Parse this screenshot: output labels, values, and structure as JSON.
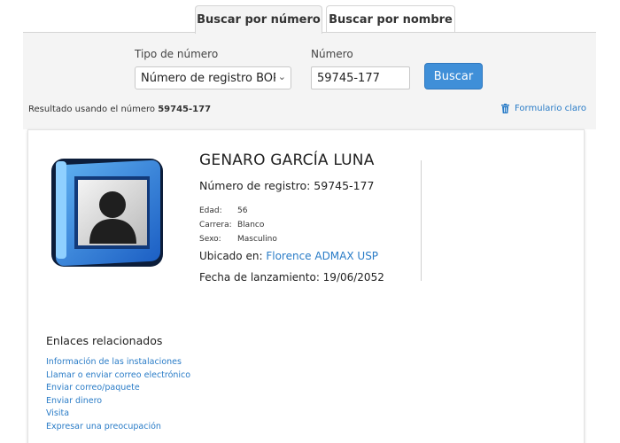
{
  "tabs": [
    {
      "label": "Buscar por número",
      "active": true
    },
    {
      "label": "Buscar por nombre",
      "active": false
    }
  ],
  "search": {
    "type_label": "Tipo de número",
    "type_value": "Número de registro BOP",
    "number_label": "Número",
    "number_value": "59745-177",
    "button_label": "Buscar"
  },
  "result": {
    "prefix": "Resultado usando el número",
    "number": "59745-177",
    "clear_label": "Formulario claro"
  },
  "person": {
    "name": "GENARO GARCÍA LUNA",
    "registration": "Número de registro: 59745-177",
    "details": [
      {
        "key": "Edad:",
        "value": "56"
      },
      {
        "key": "Carrera:",
        "value": "Blanco"
      },
      {
        "key": "Sexo:",
        "value": "Masculino"
      }
    ],
    "located_prefix": "Ubicado en:",
    "located_link": "Florence ADMAX USP",
    "release": "Fecha de lanzamiento: 19/06/2052"
  },
  "related": {
    "title": "Enlaces relacionados",
    "links": [
      "Información de las instalaciones",
      "Llamar o enviar correo electrónico",
      "Enviar correo/paquete",
      "Enviar dinero",
      "Visita",
      "Expresar una preocupación"
    ]
  },
  "colors": {
    "accent": "#3f8fd8",
    "link": "#2a7cc7",
    "panel": "#f4f4f4"
  },
  "icons": {
    "photo": "person-silhouette-icon",
    "clear": "trash-icon",
    "dropdown": "chevron-down-icon"
  }
}
